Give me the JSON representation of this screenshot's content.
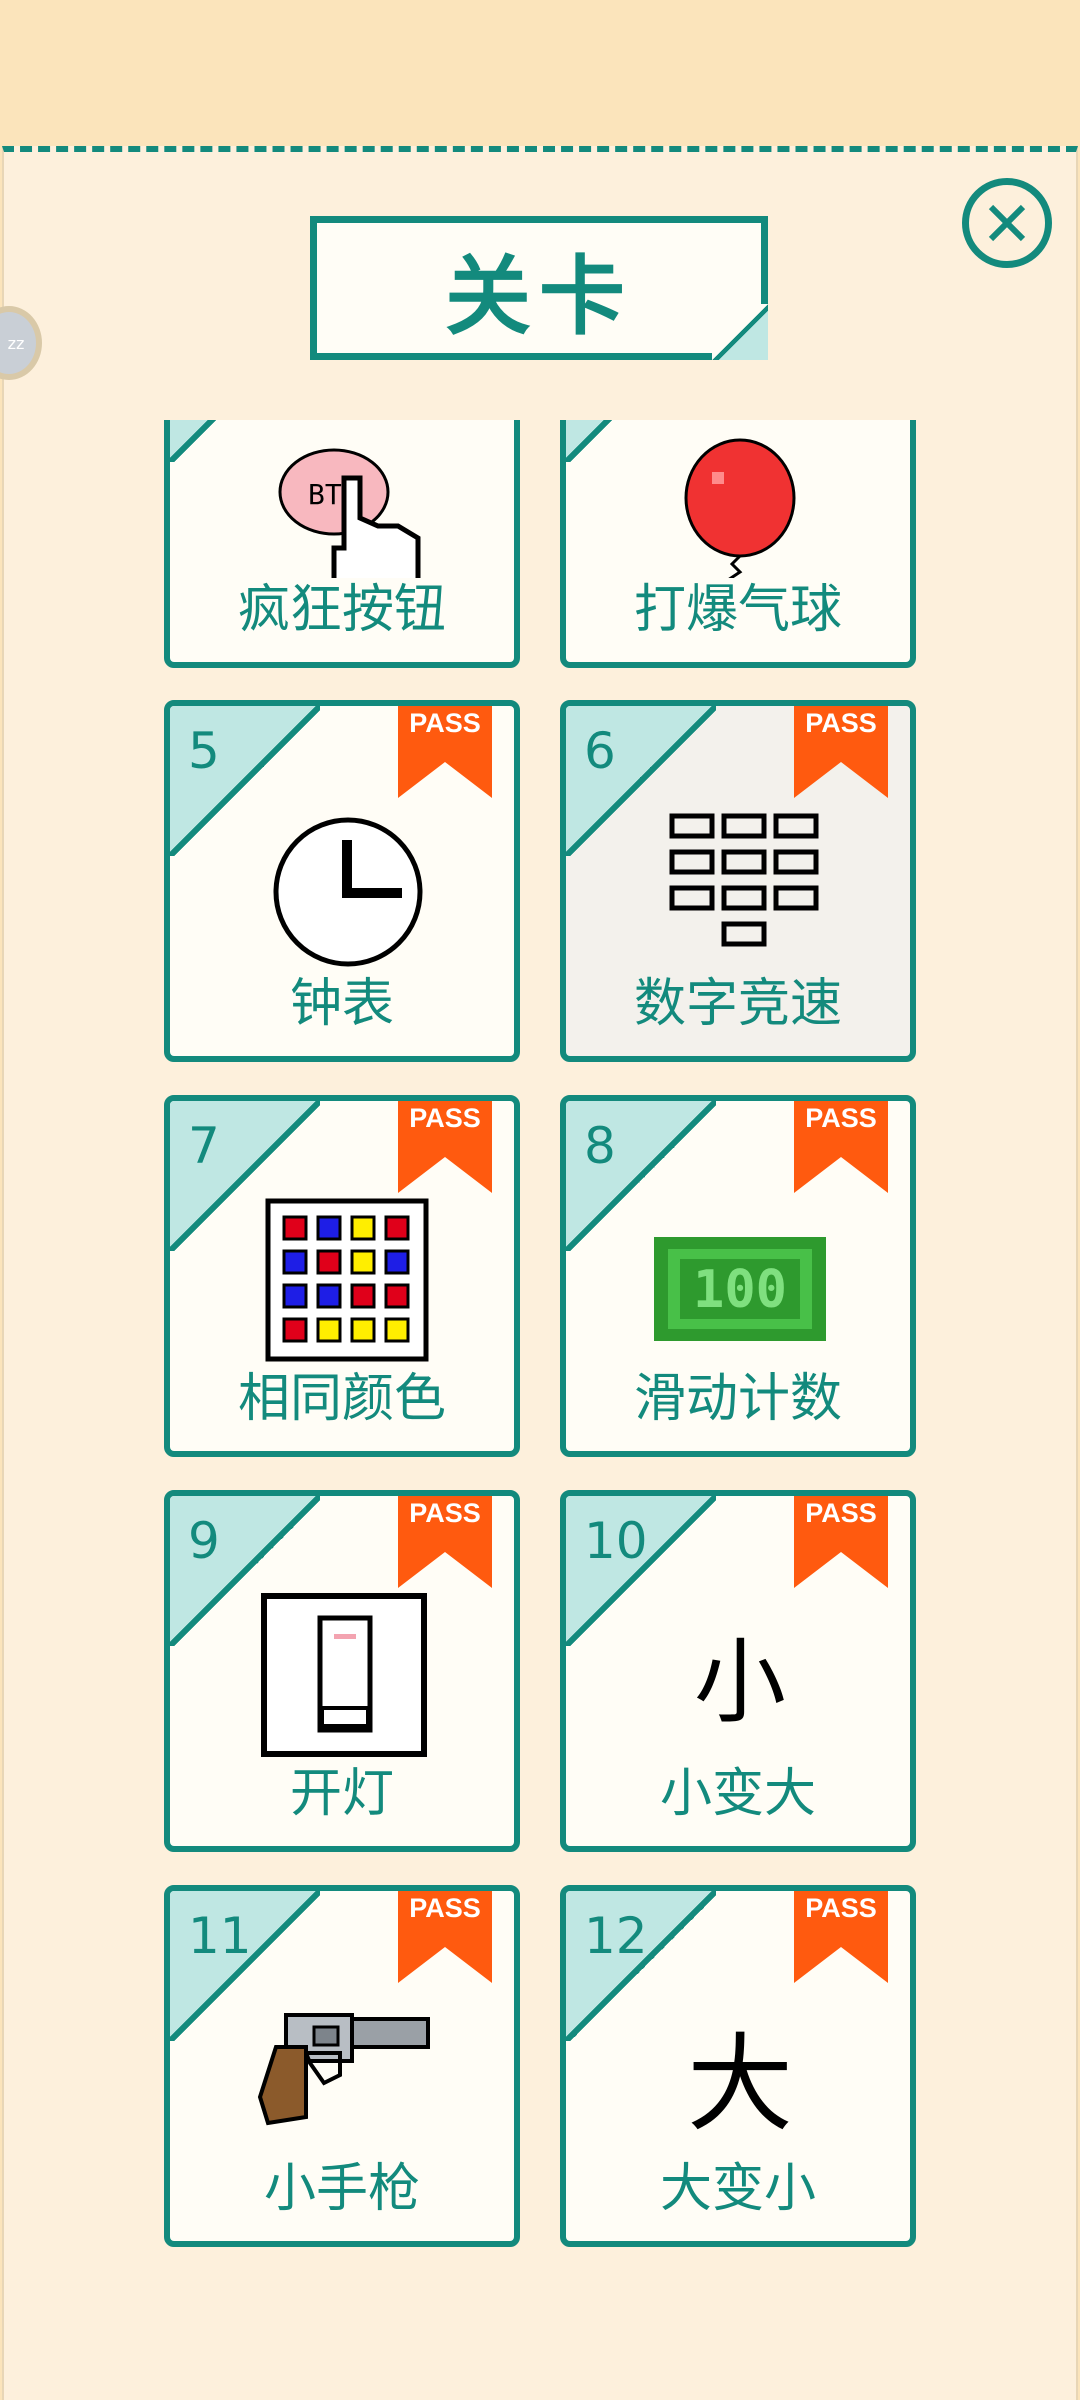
{
  "title": "关卡",
  "side_bubble_text": "zz",
  "pass_label": "PASS",
  "colors": {
    "teal": "#138a7d",
    "corner": "#bfe7e3",
    "badge": "#ff5a0f",
    "background": "#fbe4bb"
  },
  "levels": [
    {
      "number": "",
      "name": "疯狂按钮",
      "icon": "hand-press-icon",
      "passed": false
    },
    {
      "number": "",
      "name": "打爆气球",
      "icon": "balloon-icon",
      "passed": false
    },
    {
      "number": "5",
      "name": "钟表",
      "icon": "clock-icon",
      "passed": true
    },
    {
      "number": "6",
      "name": "数字竞速",
      "icon": "keypad-icon",
      "passed": true
    },
    {
      "number": "7",
      "name": "相同颜色",
      "icon": "color-grid-icon",
      "passed": true
    },
    {
      "number": "8",
      "name": "滑动计数",
      "icon": "counter-100-icon",
      "passed": true
    },
    {
      "number": "9",
      "name": "开灯",
      "icon": "light-switch-icon",
      "passed": true
    },
    {
      "number": "10",
      "name": "小变大",
      "icon": "small-char-icon",
      "passed": true
    },
    {
      "number": "11",
      "name": "小手枪",
      "icon": "revolver-icon",
      "passed": true
    },
    {
      "number": "12",
      "name": "大变小",
      "icon": "big-char-icon",
      "passed": true
    }
  ],
  "icon_text": {
    "small_char": "小",
    "big_char": "大",
    "counter": "100",
    "hand_button": "BTN"
  }
}
